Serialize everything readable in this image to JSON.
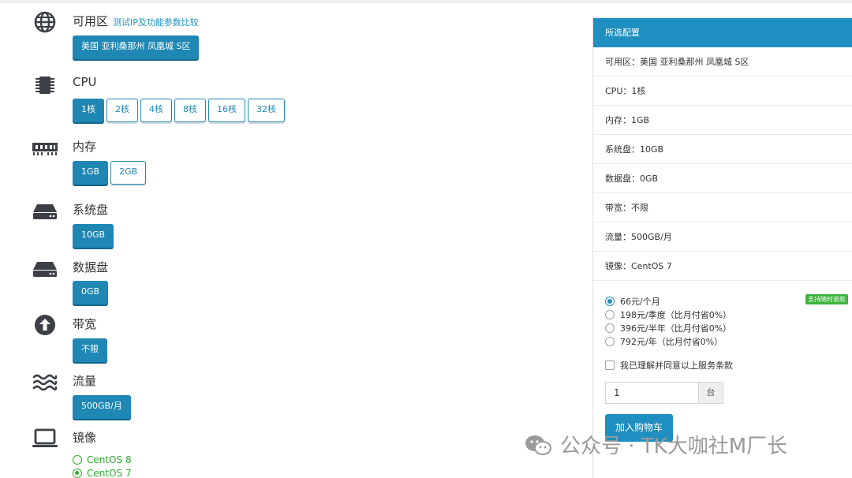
{
  "sections": {
    "zone": {
      "title": "可用区",
      "link": "测试IP及功能参数比较",
      "options": [
        "美国 亚利桑那州 凤凰城 S区"
      ],
      "selected": 0
    },
    "cpu": {
      "title": "CPU",
      "options": [
        "1核",
        "2核",
        "4核",
        "8核",
        "16核",
        "32核"
      ],
      "selected": 0
    },
    "memory": {
      "title": "内存",
      "options": [
        "1GB",
        "2GB"
      ],
      "selected": 0
    },
    "system_disk": {
      "title": "系统盘",
      "options": [
        "10GB"
      ],
      "selected": 0
    },
    "data_disk": {
      "title": "数据盘",
      "options": [
        "0GB"
      ],
      "selected": 0
    },
    "bandwidth": {
      "title": "带宽",
      "options": [
        "不限"
      ],
      "selected": 0
    },
    "traffic": {
      "title": "流量",
      "options": [
        "500GB/月"
      ],
      "selected": 0
    },
    "image": {
      "title": "镜像",
      "options": [
        "CentOS 8",
        "CentOS 7"
      ],
      "selected": 1
    }
  },
  "summary": {
    "header": "所选配置",
    "rows": [
      "可用区：美国 亚利桑那州 凤凰城 S区",
      "CPU：1核",
      "内存：1GB",
      "系统盘：10GB",
      "数据盘：0GB",
      "带宽：不限",
      "流量：500GB/月",
      "镜像：CentOS 7"
    ],
    "prices": [
      {
        "label": "66元/个月",
        "selected": true
      },
      {
        "label": "198元/季度（比月付省0%）",
        "selected": false
      },
      {
        "label": "396元/半年（比月付省0%）",
        "selected": false
      },
      {
        "label": "792元/年（比月付省0%）",
        "selected": false
      }
    ],
    "refund_badge": "支持随时退款",
    "agree_label": "我已理解并同意以上服务条款",
    "quantity": "1",
    "quantity_unit": "台",
    "cart_button": "加入购物车"
  },
  "watermark": "公众号 · TK大咖社M厂长",
  "colors": {
    "accent": "#1e87b4",
    "header": "#1e8fc0",
    "green": "#2cae2c",
    "icon": "#3c4046"
  }
}
